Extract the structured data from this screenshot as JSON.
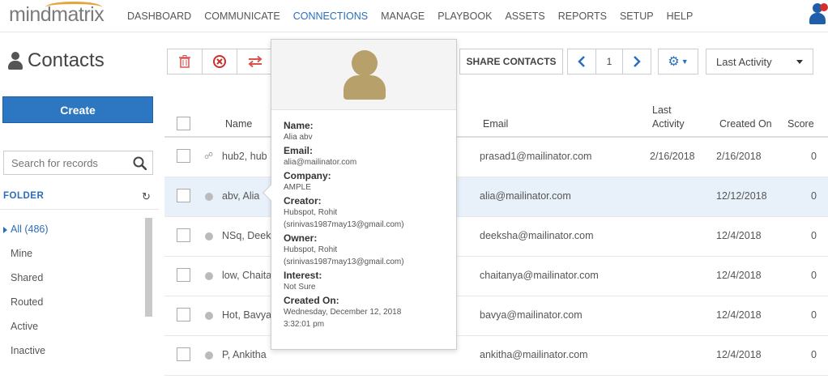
{
  "brand": {
    "logo_text": "mindmatrix"
  },
  "nav": [
    "DASHBOARD",
    "COMMUNICATE",
    "CONNECTIONS",
    "MANAGE",
    "PLAYBOOK",
    "ASSETS",
    "REPORTS",
    "SETUP",
    "HELP"
  ],
  "nav_active": "CONNECTIONS",
  "page": {
    "title": "Contacts"
  },
  "sidebar": {
    "create_label": "Create",
    "search_placeholder": "Search for records",
    "folder_label": "FOLDER",
    "folders": [
      {
        "label": "All  (486)"
      },
      {
        "label": "Mine"
      },
      {
        "label": "Shared"
      },
      {
        "label": "Routed"
      },
      {
        "label": "Active"
      },
      {
        "label": "Inactive"
      }
    ]
  },
  "toolbar": {
    "share_label": "SHARE CONTACTS",
    "page_number": "1",
    "sort_value": "Last Activity"
  },
  "table": {
    "headers": {
      "name": "Name",
      "email": "Email",
      "last_activity": "Last Activity",
      "created_on": "Created On",
      "score": "Score"
    },
    "rows": [
      {
        "name": "hub2, hub",
        "email": "prasad1@mailinator.com",
        "last_activity": "2/16/2018",
        "created_on": "2/16/2018",
        "score": "0",
        "shared": true
      },
      {
        "name": "abv, Alia",
        "email": "alia@mailinator.com",
        "last_activity": "",
        "created_on": "12/12/2018",
        "score": "0",
        "shared": false
      },
      {
        "name": "NSq, Deek",
        "email": "deeksha@mailinator.com",
        "last_activity": "",
        "created_on": "12/4/2018",
        "score": "0",
        "shared": false
      },
      {
        "name": "low, Chaita",
        "email": "chaitanya@mailinator.com",
        "last_activity": "",
        "created_on": "12/4/2018",
        "score": "0",
        "shared": false
      },
      {
        "name": "Hot, Bavya",
        "email": "bavya@mailinator.com",
        "last_activity": "",
        "created_on": "12/4/2018",
        "score": "0",
        "shared": false
      },
      {
        "name": "P, Ankitha",
        "email": "ankitha@mailinator.com",
        "last_activity": "",
        "created_on": "12/4/2018",
        "score": "0",
        "shared": false
      }
    ]
  },
  "popover": {
    "fields": [
      {
        "label": "Name:",
        "value": "Alia abv"
      },
      {
        "label": "Email:",
        "value": "alia@mailinator.com"
      },
      {
        "label": "Company:",
        "value": "AMPLE"
      },
      {
        "label": "Creator:",
        "value": "Hubspot, Rohit (srinivas1987may13@gmail.com)"
      },
      {
        "label": "Owner:",
        "value": "Hubspot, Rohit (srinivas1987may13@gmail.com)"
      },
      {
        "label": "Interest:",
        "value": "Not Sure"
      },
      {
        "label": "Created On:",
        "value": "Wednesday, December 12, 2018 3:32:01 pm"
      }
    ]
  },
  "colors": {
    "accent": "#2a6ebb",
    "create_button": "#2d77c2",
    "avatar": "#b8a06b",
    "logo_arc": "#e8a33b"
  }
}
